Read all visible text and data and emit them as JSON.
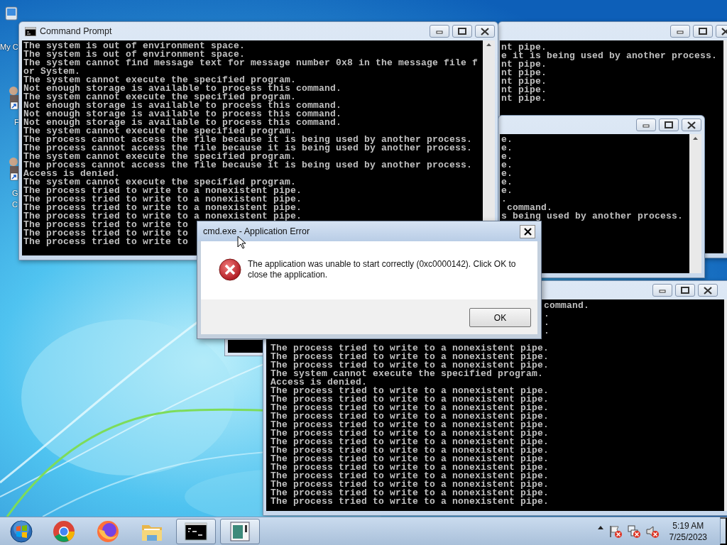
{
  "desktop_icons": [
    {
      "label": "My C"
    },
    {
      "label": "F"
    },
    {
      "label": "G C"
    }
  ],
  "windows": [
    {
      "kind": "console",
      "lines": [
        "nt pipe.",
        "e it is being used by another process.",
        "nt pipe.",
        "nt pipe.",
        "nt pipe.",
        "nt pipe.",
        "nt pipe."
      ]
    },
    {
      "kind": "console",
      "lines": [
        "e.",
        "e.",
        "e.",
        "e.",
        "e.",
        "e.",
        "e.",
        ".",
        " command.",
        "s being used by another process."
      ]
    },
    {
      "kind": "frame"
    },
    {
      "kind": "console",
      "tail_lines": [
        "command.",
        ".",
        ".",
        "."
      ],
      "lines": [
        "The process tried to write to a nonexistent pipe.",
        "The process tried to write to a nonexistent pipe.",
        "The process tried to write to a nonexistent pipe.",
        "The system cannot execute the specified program.",
        "Access is denied.",
        "The process tried to write to a nonexistent pipe.",
        "The process tried to write to a nonexistent pipe.",
        "The process tried to write to a nonexistent pipe.",
        "The process tried to write to a nonexistent pipe.",
        "The process tried to write to a nonexistent pipe.",
        "The process tried to write to a nonexistent pipe.",
        "The process tried to write to a nonexistent pipe.",
        "The process tried to write to a nonexistent pipe.",
        "The process tried to write to a nonexistent pipe.",
        "The process tried to write to a nonexistent pipe.",
        "The process tried to write to a nonexistent pipe.",
        "The process tried to write to a nonexistent pipe.",
        "The process tried to write to a nonexistent pipe.",
        "The process tried to write to a nonexistent pipe."
      ]
    },
    {
      "kind": "console",
      "title": "Command Prompt",
      "lines": [
        "The system is out of environment space.",
        "The system is out of environment space.",
        "The system cannot find message text for message number 0x8 in the message file f",
        "or System.",
        "The system cannot execute the specified program.",
        "Not enough storage is available to process this command.",
        "The system cannot execute the specified program.",
        "Not enough storage is available to process this command.",
        "Not enough storage is available to process this command.",
        "Not enough storage is available to process this command.",
        "The system cannot execute the specified program.",
        "The process cannot access the file because it is being used by another process.",
        "The process cannot access the file because it is being used by another process.",
        "The system cannot execute the specified program.",
        "The process cannot access the file because it is being used by another process.",
        "Access is denied.",
        "The system cannot execute the specified program.",
        "The process tried to write to a nonexistent pipe.",
        "The process tried to write to a nonexistent pipe.",
        "The process tried to write to a nonexistent pipe.",
        "The process tried to write to a nonexistent pipe.",
        "The process tried to write to",
        "The process tried to write to",
        "The process tried to write to"
      ]
    }
  ],
  "dialog": {
    "title": "cmd.exe - Application Error",
    "message": "The application was unable to start correctly (0xc0000142). Click OK to close the application.",
    "buttons": [
      "OK"
    ]
  },
  "taskbar": {
    "items": [
      {
        "kind": "start",
        "running": false
      },
      {
        "kind": "ring-browser",
        "running": false
      },
      {
        "kind": "fox-browser",
        "running": false
      },
      {
        "kind": "folder",
        "running": false
      },
      {
        "kind": "console",
        "running": true
      },
      {
        "kind": "app",
        "running": true
      }
    ],
    "tray": {
      "icons": [
        {
          "kind": "arrow"
        },
        {
          "kind": "flag"
        },
        {
          "kind": "network"
        },
        {
          "kind": "speaker"
        }
      ],
      "time": "5:19 AM",
      "date": "7/25/2023"
    }
  }
}
